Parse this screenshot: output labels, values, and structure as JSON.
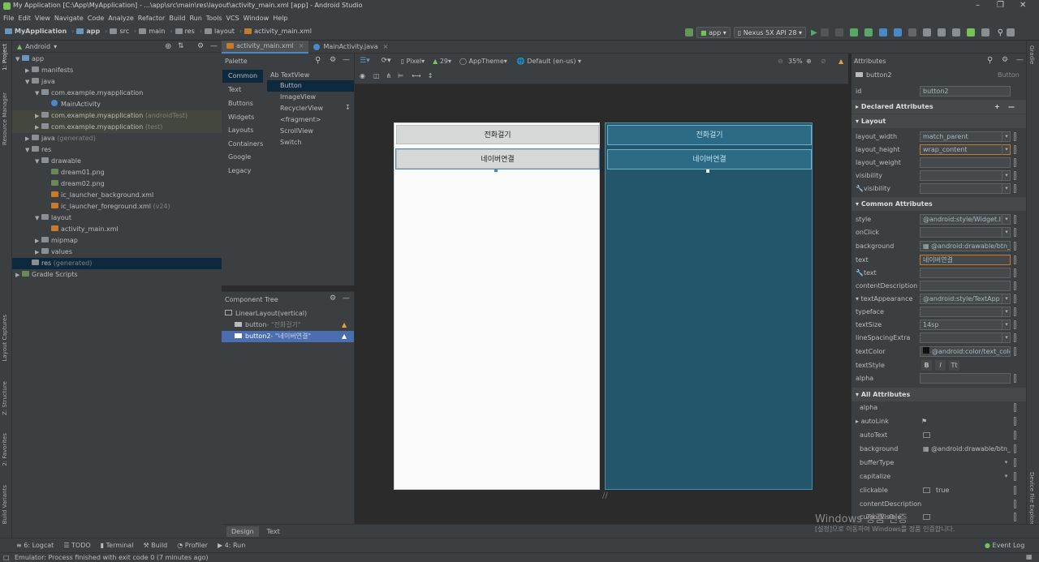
{
  "window": {
    "title": "My Application [C:\\App\\MyApplication] - ...\\app\\src\\main\\res\\layout\\activity_main.xml [app] - Android Studio"
  },
  "menu": [
    "File",
    "Edit",
    "View",
    "Navigate",
    "Code",
    "Analyze",
    "Refactor",
    "Build",
    "Run",
    "Tools",
    "VCS",
    "Window",
    "Help"
  ],
  "breadcrumb": [
    "MyApplication",
    "app",
    "src",
    "main",
    "res",
    "layout",
    "activity_main.xml"
  ],
  "run_toolbar": {
    "config": "app",
    "device": "Nexus 5X API 28"
  },
  "left_strip": [
    "1: Project",
    "Resource Manager",
    "Layout Captures",
    "Z: Structure",
    "2: Favorites",
    "Build Variants"
  ],
  "project": {
    "view": "Android",
    "tree": [
      {
        "label": "app",
        "extra": ""
      },
      {
        "label": "manifests",
        "extra": ""
      },
      {
        "label": "java",
        "extra": ""
      },
      {
        "label": "com.example.myapplication",
        "extra": ""
      },
      {
        "label": "MainActivity",
        "extra": ""
      },
      {
        "label": "com.example.myapplication",
        "extra": "(androidTest)"
      },
      {
        "label": "com.example.myapplication",
        "extra": "(test)"
      },
      {
        "label": "java",
        "extra": "(generated)"
      },
      {
        "label": "res",
        "extra": ""
      },
      {
        "label": "drawable",
        "extra": ""
      },
      {
        "label": "dream01.png",
        "extra": ""
      },
      {
        "label": "dream02.png",
        "extra": ""
      },
      {
        "label": "ic_launcher_background.xml",
        "extra": ""
      },
      {
        "label": "ic_launcher_foreground.xml",
        "extra": "(v24)"
      },
      {
        "label": "layout",
        "extra": ""
      },
      {
        "label": "activity_main.xml",
        "extra": ""
      },
      {
        "label": "mipmap",
        "extra": ""
      },
      {
        "label": "values",
        "extra": ""
      },
      {
        "label": "res",
        "extra": "(generated)"
      },
      {
        "label": "Gradle Scripts",
        "extra": ""
      }
    ]
  },
  "editor_tabs": [
    "activity_main.xml",
    "MainActivity.java"
  ],
  "palette": {
    "title": "Palette",
    "categories": [
      "Common",
      "Text",
      "Buttons",
      "Widgets",
      "Layouts",
      "Containers",
      "Google",
      "Legacy"
    ],
    "items": [
      "Ab TextView",
      "Button",
      "ImageView",
      "RecyclerView",
      "<fragment>",
      "ScrollView",
      "Switch"
    ]
  },
  "design_toolbar": {
    "device": "Pixel",
    "api": "29",
    "theme": "AppTheme",
    "locale": "Default (en-us)",
    "zoom": "35%"
  },
  "component_tree": {
    "title": "Component Tree",
    "root": "LinearLayout",
    "root_extra": "(vertical)",
    "children": [
      {
        "id": "button",
        "text": "- \"전화걸기\""
      },
      {
        "id": "button2",
        "text": "- \"네이버연결\""
      }
    ]
  },
  "preview": {
    "button1": "전화걸기",
    "button2": "네이버연결"
  },
  "attributes": {
    "title": "Attributes",
    "widget": "button2",
    "widget_type": "Button",
    "id_label": "id",
    "id_value": "button2",
    "declared": "Declared Attributes",
    "layout_section": "Layout",
    "layout": [
      {
        "label": "layout_width",
        "value": "match_parent"
      },
      {
        "label": "layout_height",
        "value": "wrap_content"
      },
      {
        "label": "layout_weight",
        "value": ""
      },
      {
        "label": "visibility",
        "value": ""
      },
      {
        "label": "visibility",
        "value": ""
      }
    ],
    "common_section": "Common Attributes",
    "common": [
      {
        "label": "style",
        "value": "@android:style/Widget.I"
      },
      {
        "label": "onClick",
        "value": ""
      },
      {
        "label": "background",
        "value": "@android:drawable/btn_de"
      },
      {
        "label": "text",
        "value": "네이버연결"
      },
      {
        "label": "text",
        "value": ""
      },
      {
        "label": "contentDescription",
        "value": ""
      },
      {
        "label": "textAppearance",
        "value": "@android:style/TextApp"
      },
      {
        "label": "typeface",
        "value": ""
      },
      {
        "label": "textSize",
        "value": "14sp"
      },
      {
        "label": "lineSpacingExtra",
        "value": ""
      },
      {
        "label": "textColor",
        "value": "@android:color/text_color_"
      },
      {
        "label": "textStyle",
        "value": ""
      },
      {
        "label": "alpha",
        "value": ""
      }
    ],
    "all_section": "All Attributes",
    "all": [
      {
        "label": "alpha",
        "value": ""
      },
      {
        "label": "autoLink",
        "value": ""
      },
      {
        "label": "autoText",
        "value": ""
      },
      {
        "label": "background",
        "value": "@android:drawable/btn_de"
      },
      {
        "label": "bufferType",
        "value": ""
      },
      {
        "label": "capitalize",
        "value": ""
      },
      {
        "label": "clickable",
        "value": "true"
      },
      {
        "label": "contentDescription",
        "value": ""
      },
      {
        "label": "cursorVisible",
        "value": ""
      }
    ]
  },
  "right_strip": [
    "Gradle",
    "Device File Explorer"
  ],
  "bottom_tabs": [
    "Design",
    "Text"
  ],
  "tool_windows": [
    "6: Logcat",
    "TODO",
    "Terminal",
    "Build",
    "Profiler",
    "4: Run"
  ],
  "event_log": "Event Log",
  "status": "Emulator: Process finished with exit code 0 (7 minutes ago)",
  "watermark": {
    "line1": "Windows 정품 인증",
    "line2": "[설정]으로 이동하여 Windows를 정품 인증합니다."
  }
}
